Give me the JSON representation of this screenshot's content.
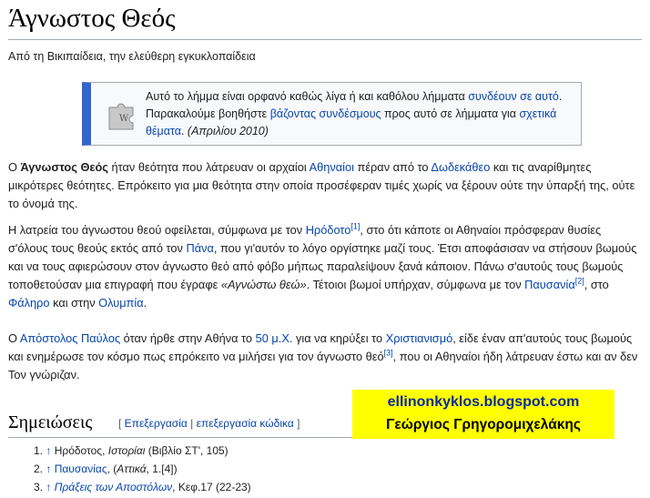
{
  "page": {
    "title": "Άγνωστος Θεός",
    "tagline": "Από τη Βικιπαίδεια, την ελεύθερη εγκυκλοπαίδεια"
  },
  "notice": {
    "icon": "puzzle-piece-icon",
    "t1": "Αυτό το λήμμα είναι ορφανό καθώς λίγα ή και καθόλου λήμματα ",
    "l1": "συνδέουν σε αυτό",
    "t2": ". Παρακαλούμε βοηθήστε ",
    "l2": "βάζοντας συνδέσμους",
    "t3": " προς αυτό σε λήμματα για ",
    "l3": "σχετικά θέματα",
    "t4": ". ",
    "date": "(Απριλίου 2010)"
  },
  "p1": {
    "a": "Ο ",
    "b": "Άγνωστος Θεός",
    "c": " ήταν θεότητα που λάτρευαν οι αρχαίοι ",
    "l1": "Αθηναίοι",
    "d": " πέραν από το ",
    "l2": "Δωδεκάθεο",
    "e": " και τις αναρίθμητες μικρότερες θεότητες. Επρόκειτο για μια θεότητα στην οποία προσέφεραν τιμές χωρίς να ξέρουν ούτε την ύπαρξή της, ούτε το όνομά της."
  },
  "p2": {
    "a": "Η λατρεία του άγνωστου θεού οφείλεται, σύμφωνα με τον ",
    "l1": "Ηρόδοτο",
    "s1": "[1]",
    "b": ", στο ότι κάποτε οι Αθηναίοι πρόσφεραν θυσίες σ'όλους τους θεούς εκτός από τον ",
    "l2": "Πάνα",
    "c": ", που γι'αυτόν το λόγο οργίστηκε μαζί τους. Έτσι αποφάσισαν να στήσουν βωμούς και να τους αφιερώσουν στον άγνωστο θεό από φόβο μήπως παραλείψουν ξανά κάποιον. Πάνω σ'αυτούς τους βωμούς τοποθετούσαν μια επιγραφή που έγραφε ",
    "q": "«Αγνώστω θεώ»",
    "d": ". Τέτοιοι βωμοί υπήρχαν, σύμφωνα με τον ",
    "l3": "Παυσανία",
    "s2": "[2]",
    "e": ", στο ",
    "l4": "Φάληρο",
    "f": " και στην ",
    "l5": "Ολυμπία",
    "g": "."
  },
  "p3": {
    "a": "Ο ",
    "l1": "Απόστολος Παύλος",
    "b": " όταν ήρθε στην Αθήνα το ",
    "l2": "50 μ.Χ.",
    "c": " για να κηρύξει το ",
    "l3": "Χριστιανισμό",
    "d": ", είδε έναν απ'αυτούς τους βωμούς και ενημέρωσε τον κόσμο πως επρόκειτο να μιλήσει για τον άγνωστο θεό",
    "s1": "[3]",
    "e": ", που οι Αθηναίοι ήδη λάτρευαν έστω και αν δεν Τον γνώριζαν."
  },
  "notes": {
    "heading": "Σημειώσεις",
    "edit_open": "[ ",
    "edit": "Επεξεργασία",
    "sep": " | ",
    "edit_code": "επεξεργασία κώδικα",
    "edit_close": " ]",
    "refs": [
      {
        "num": "1.",
        "caret": "↑",
        "pre": "",
        "link": "",
        "text": "Ηρόδοτος, ",
        "ital": "Ιστορίαι",
        "post": " (Βιβλίο ΣΤ', 105)"
      },
      {
        "num": "2.",
        "caret": "↑",
        "pre": "",
        "link": "Παυσανίας",
        "text": ", (",
        "ital": "Αττικά",
        "post": ", 1.[4])"
      },
      {
        "num": "3.",
        "caret": "↑",
        "pre": "",
        "link": "Πράξεις των Αποστόλων",
        "text": ", Κεφ.17 (22-23)",
        "ital": "",
        "post": ""
      }
    ]
  },
  "watermark": {
    "line1": "ellinonkyklos.blogspot.com",
    "line2": "Γεώργιος Γρηγορομιχελάκης",
    "bg": "#ffff00"
  },
  "colors": {
    "link": "#0645ad",
    "notice_border": "#3366cc"
  }
}
